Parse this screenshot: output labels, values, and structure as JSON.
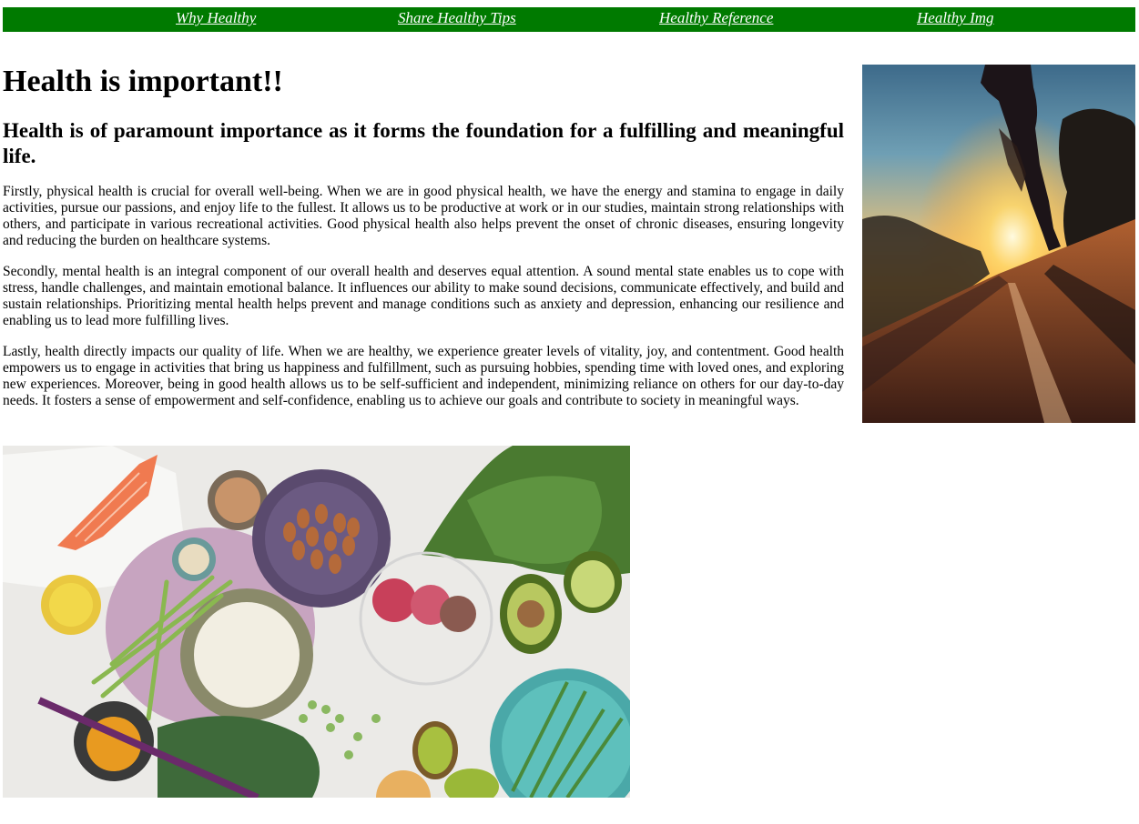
{
  "nav": {
    "bg_color": "#007a00",
    "links": [
      {
        "label": "Why Healthy"
      },
      {
        "label": "Share Healthy Tips"
      },
      {
        "label": "Healthy Reference"
      },
      {
        "label": "Healthy Img"
      }
    ]
  },
  "content": {
    "title": "Health is important!!",
    "subtitle": "Health is of paramount importance as it forms the foundation for a fulfilling and meaningful life.",
    "paragraphs": [
      "Firstly, physical health is crucial for overall well-being. When we are in good physical health, we have the energy and stamina to engage in daily activities, pursue our passions, and enjoy life to the fullest. It allows us to be productive at work or in our studies, maintain strong relationships with others, and participate in various recreational activities. Good physical health also helps prevent the onset of chronic diseases, ensuring longevity and reducing the burden on healthcare systems.",
      "Secondly, mental health is an integral component of our overall health and deserves equal attention. A sound mental state enables us to cope with stress, handle challenges, and maintain emotional balance. It influences our ability to make sound decisions, communicate effectively, and build and sustain relationships. Prioritizing mental health helps prevent and manage conditions such as anxiety and depression, enhancing our resilience and enabling us to lead more fulfilling lives.",
      "Lastly, health directly impacts our quality of life. When we are healthy, we experience greater levels of vitality, joy, and contentment. Good health empowers us to engage in activities that bring us happiness and fulfillment, such as pursuing hobbies, spending time with loved ones, and exploring new experiences. Moreover, being in good health allows us to be self-sufficient and independent, minimizing reliance on others for our day-to-day needs. It fosters a sense of empowerment and self-confidence, enabling us to achieve our goals and contribute to society in meaningful ways."
    ]
  }
}
